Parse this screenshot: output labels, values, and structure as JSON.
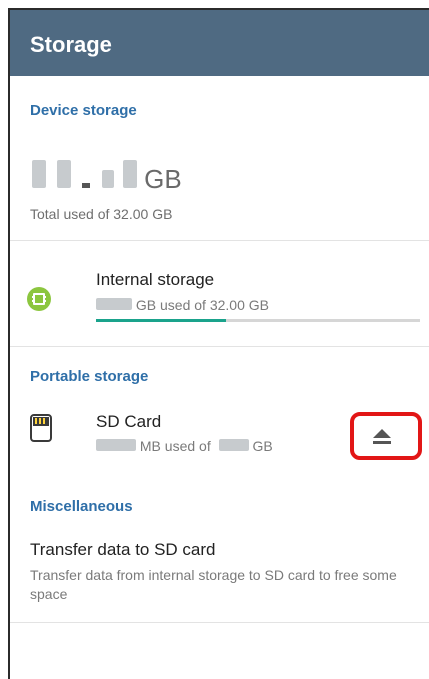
{
  "appbar": {
    "title": "Storage"
  },
  "device_storage": {
    "header": "Device storage",
    "total_unit": "GB",
    "total_caption": "Total used of 32.00 GB"
  },
  "internal_storage": {
    "title": "Internal storage",
    "sub_suffix": "GB used of 32.00 GB",
    "progress_fraction": 0.4
  },
  "portable_storage": {
    "header": "Portable storage",
    "sd_title": "SD Card",
    "sd_sub_mid": "MB used of",
    "sd_sub_unit": "GB"
  },
  "misc": {
    "header": "Miscellaneous",
    "transfer_title": "Transfer data to SD card",
    "transfer_sub": "Transfer data from internal storage to SD card to free some space"
  },
  "colors": {
    "appbar": "#4f6a82",
    "accent_header": "#2f6fa8",
    "progress": "#1aa38c",
    "highlight": "#e21616",
    "internal_icon": "#8cc63f"
  }
}
